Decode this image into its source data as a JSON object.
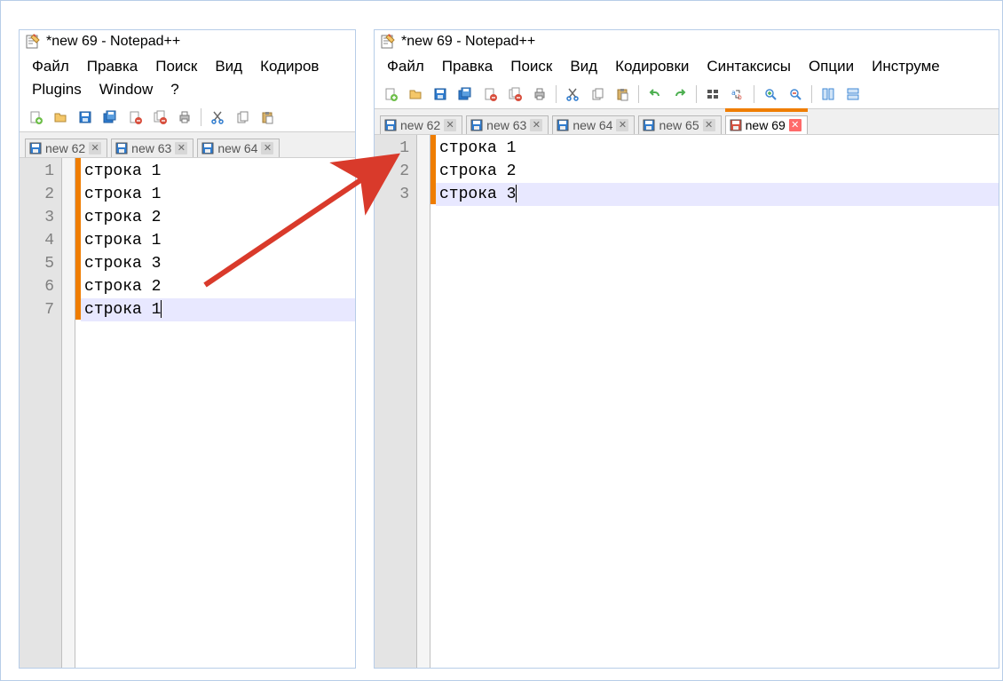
{
  "app_title": "*new 69 - Notepad++",
  "left_window": {
    "menus": [
      "Файл",
      "Правка",
      "Поиск",
      "Вид",
      "Кодиров",
      "Plugins",
      "Window",
      "?"
    ],
    "tabs": [
      {
        "label": "new 62",
        "modified": false,
        "active": false
      },
      {
        "label": "new 63",
        "modified": false,
        "active": false
      },
      {
        "label": "new 64",
        "modified": false,
        "active": false
      }
    ],
    "lines": [
      "строка 1",
      "строка 1",
      "строка 2",
      "строка 1",
      "строка 3",
      "строка 2",
      "строка 1"
    ],
    "current_line_index": 6
  },
  "right_window": {
    "menus": [
      "Файл",
      "Правка",
      "Поиск",
      "Вид",
      "Кодировки",
      "Синтаксисы",
      "Опции",
      "Инструме"
    ],
    "tabs": [
      {
        "label": "new 62",
        "modified": false,
        "active": false
      },
      {
        "label": "new 63",
        "modified": false,
        "active": false
      },
      {
        "label": "new 64",
        "modified": false,
        "active": false
      },
      {
        "label": "new 65",
        "modified": false,
        "active": false
      },
      {
        "label": "new 69",
        "modified": true,
        "active": true
      }
    ],
    "lines": [
      "строка 1",
      "строка 2",
      "строка 3"
    ],
    "current_line_index": 2
  },
  "toolbar_icons": [
    "new-file-icon",
    "open-file-icon",
    "save-icon",
    "save-all-icon",
    "close-icon",
    "close-all-icon",
    "print-icon",
    "sep",
    "cut-icon",
    "copy-icon",
    "paste-icon",
    "sep",
    "undo-icon",
    "redo-icon",
    "sep",
    "find-icon",
    "replace-icon",
    "sep",
    "zoom-in-icon",
    "zoom-out-icon",
    "sep",
    "sync-v-icon",
    "sync-h-icon"
  ],
  "colors": {
    "accent_orange": "#ef7d00",
    "arrow_red": "#d93a2b",
    "save_blue": "#2f7ccf",
    "save_red": "#d84f3e"
  }
}
